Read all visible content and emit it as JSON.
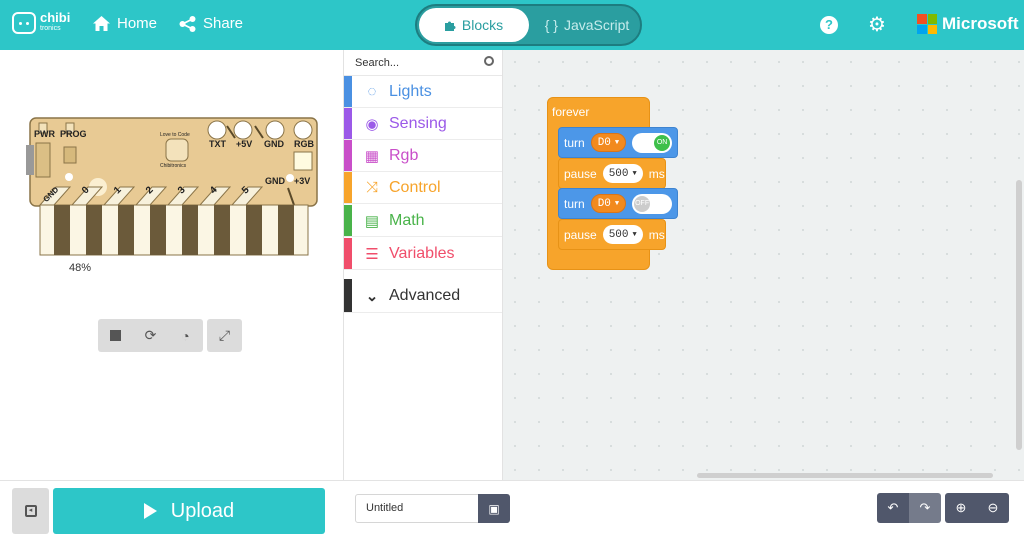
{
  "topbar": {
    "logo_text": "chibi",
    "logo_sub": "tronics",
    "home_label": "Home",
    "share_label": "Share",
    "blocks_label": "Blocks",
    "javascript_label": "JavaScript",
    "brand_label": "Microsoft"
  },
  "simulator": {
    "zoom_percent": "48%",
    "board": {
      "pins": [
        "0",
        "1",
        "2",
        "3",
        "4",
        "5"
      ],
      "labels": [
        "PWR",
        "PROG",
        "TXT",
        "+5V",
        "GND",
        "RGB",
        "GND",
        "+3V",
        "GND"
      ],
      "badge_title": "Love to Code",
      "badge_name": "Chibitronics"
    }
  },
  "toolbox": {
    "search_placeholder": "Search...",
    "categories": [
      {
        "label": "Lights",
        "color": "#4a90e2",
        "icon": "lightbulb-icon"
      },
      {
        "label": "Sensing",
        "color": "#9b59e8",
        "icon": "target-icon"
      },
      {
        "label": "Rgb",
        "color": "#c94fc9",
        "icon": "grid-icon"
      },
      {
        "label": "Control",
        "color": "#f7a42b",
        "icon": "shuffle-icon"
      },
      {
        "label": "Math",
        "color": "#49b34a",
        "icon": "calculator-icon"
      },
      {
        "label": "Variables",
        "color": "#f04e6b",
        "icon": "list-icon"
      },
      {
        "label": "Advanced",
        "color": "#333333",
        "icon": "chevron-down-icon"
      }
    ]
  },
  "workspace": {
    "forever_label": "forever",
    "blocks": [
      {
        "kind": "turn",
        "label": "turn",
        "pin": "D0",
        "state": "ON"
      },
      {
        "kind": "pause",
        "label": "pause",
        "value": "500",
        "unit": "ms"
      },
      {
        "kind": "turn",
        "label": "turn",
        "pin": "D0",
        "state": "OFF"
      },
      {
        "kind": "pause",
        "label": "pause",
        "value": "500",
        "unit": "ms"
      }
    ]
  },
  "footer": {
    "upload_label": "Upload",
    "project_name": "Untitled"
  },
  "colors": {
    "accent": "#2dc6c8",
    "dark_button": "#50576b"
  }
}
